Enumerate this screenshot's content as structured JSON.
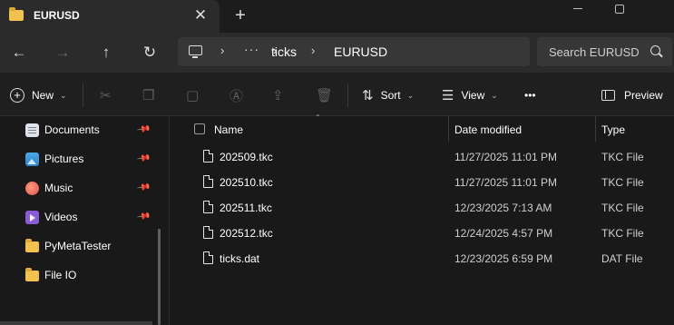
{
  "window": {
    "tab_title": "EURUSD",
    "tab_close": "✕",
    "new_tab": "+"
  },
  "nav": {
    "back": "←",
    "forward": "→",
    "up": "↑",
    "refresh": "↻",
    "path_overflow": "···",
    "path": [
      "ticks",
      "EURUSD"
    ],
    "path_separator": "›",
    "search_placeholder": "Search EURUSD"
  },
  "toolbar": {
    "new_label": "New",
    "sort_label": "Sort",
    "view_label": "View",
    "more_label": "•••",
    "preview_label": "Preview"
  },
  "sidebar": {
    "items": [
      {
        "label": "Documents",
        "icon": "documents-icon",
        "pinned": true
      },
      {
        "label": "Pictures",
        "icon": "pictures-icon",
        "pinned": true
      },
      {
        "label": "Music",
        "icon": "music-icon",
        "pinned": true
      },
      {
        "label": "Videos",
        "icon": "videos-icon",
        "pinned": true
      },
      {
        "label": "PyMetaTester",
        "icon": "folder-icon",
        "pinned": false
      },
      {
        "label": "File IO",
        "icon": "folder-icon",
        "pinned": false
      }
    ]
  },
  "columns": {
    "name": "Name",
    "date_modified": "Date modified",
    "type": "Type"
  },
  "files": [
    {
      "name": "202509.tkc",
      "date": "11/27/2025 11:01 PM",
      "type": "TKC File"
    },
    {
      "name": "202510.tkc",
      "date": "11/27/2025 11:01 PM",
      "type": "TKC File"
    },
    {
      "name": "202511.tkc",
      "date": "12/23/2025 7:13 AM",
      "type": "TKC File"
    },
    {
      "name": "202512.tkc",
      "date": "12/24/2025 4:57 PM",
      "type": "TKC File"
    },
    {
      "name": "ticks.dat",
      "date": "12/23/2025 6:59 PM",
      "type": "DAT File"
    }
  ],
  "colors": {
    "background": "#191919",
    "titlebar": "#1c1c1c",
    "navbar": "#2b2b2b",
    "folder": "#f2c14e"
  }
}
